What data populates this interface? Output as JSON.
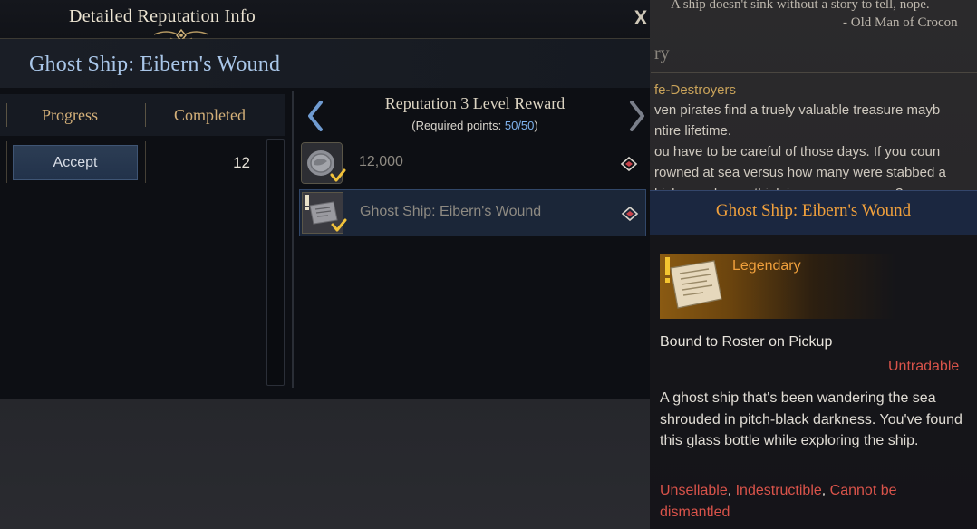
{
  "window": {
    "title": "Detailed Reputation Info",
    "close_label": "X",
    "quest_title": "Ghost Ship: Eibern's Wound"
  },
  "table": {
    "headers": {
      "progress": "Progress",
      "completed": "Completed"
    },
    "row": {
      "action": "Accept",
      "completed": "12"
    }
  },
  "reward_panel": {
    "title": "Reputation 3 Level Reward",
    "required_prefix": "(Required points: ",
    "required_value": "50/50",
    "required_suffix": ")",
    "items": [
      {
        "label": "12,000",
        "icon": "silver-coin-icon",
        "claimed": true
      },
      {
        "label": "Ghost Ship: Eibern's Wound",
        "icon": "map-scroll-icon",
        "claimed": true,
        "selected": true
      }
    ]
  },
  "tooltip": {
    "name": "Ghost Ship: Eibern's Wound",
    "grade": "Legendary",
    "bound": "Bound to Roster on Pickup",
    "tradability": "Untradable",
    "description": "A ghost ship that's been wandering the sea shrouded in pitch-black darkness. You've found this glass bottle while exploring the ship.",
    "flags": [
      "Unsellable",
      "Indestructible",
      "Cannot be dismantled"
    ]
  },
  "background_book": {
    "quote": "A ship doesn't sink without a story to tell, nope.",
    "author": "- Old Man of Crocon",
    "heading": "ry",
    "subheading": "fe-Destroyers",
    "lines": [
      "ven pirates find a truely valuable treasure mayb",
      "ntire lifetime.",
      "ou have to be careful of those days. If you coun",
      "rowned at sea versus how many were stabbed a",
      "hich one do you think is more numerous?"
    ]
  },
  "colors": {
    "quest_title": "#a9c6e8",
    "header_gold": "#d4b079",
    "legendary": "#f0a03c",
    "warning_red": "#d9534a",
    "points_blue": "#7fb3ee"
  }
}
